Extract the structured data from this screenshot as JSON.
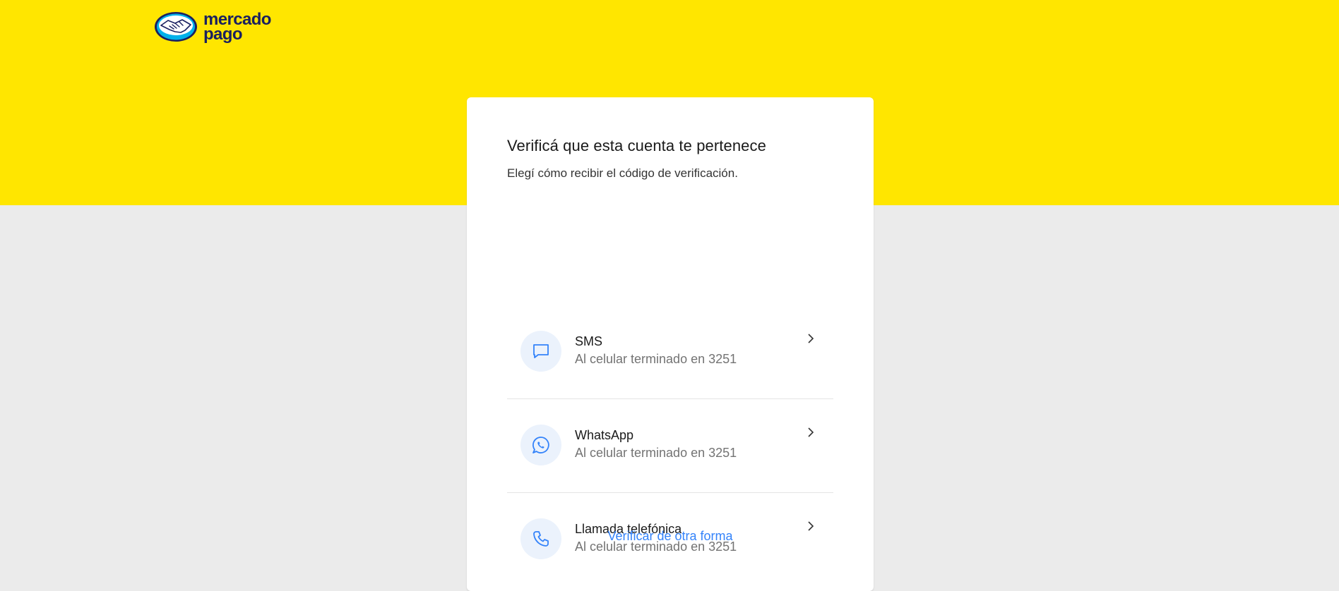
{
  "brand": {
    "line1": "mercado",
    "line2": "pago",
    "band_color": "#ffe600",
    "text_color": "#1a2060"
  },
  "verification": {
    "title": "Verificá que esta cuenta te pertenece",
    "subtitle": "Elegí cómo recibir el código de verificación.",
    "options": [
      {
        "icon": "chat-bubble-icon",
        "label": "SMS",
        "description": "Al celular terminado en 3251"
      },
      {
        "icon": "whatsapp-icon",
        "label": "WhatsApp",
        "description": "Al celular terminado en 3251"
      },
      {
        "icon": "phone-icon",
        "label": "Llamada telefónica",
        "description": "Al celular terminado en 3251"
      }
    ],
    "other_link": "Verificar de otra forma",
    "accent_color": "#3483fa"
  }
}
